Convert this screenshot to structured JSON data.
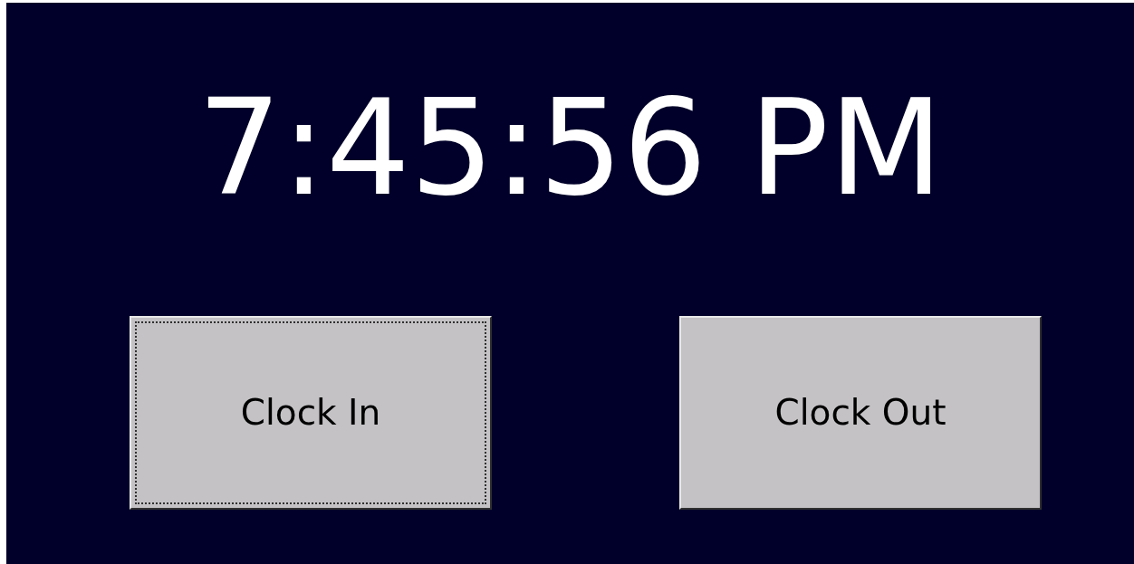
{
  "clock": {
    "time": "7:45:56 PM"
  },
  "buttons": [
    {
      "label": "Clock In",
      "focused": true
    },
    {
      "label": "Clock Out",
      "focused": false
    }
  ]
}
